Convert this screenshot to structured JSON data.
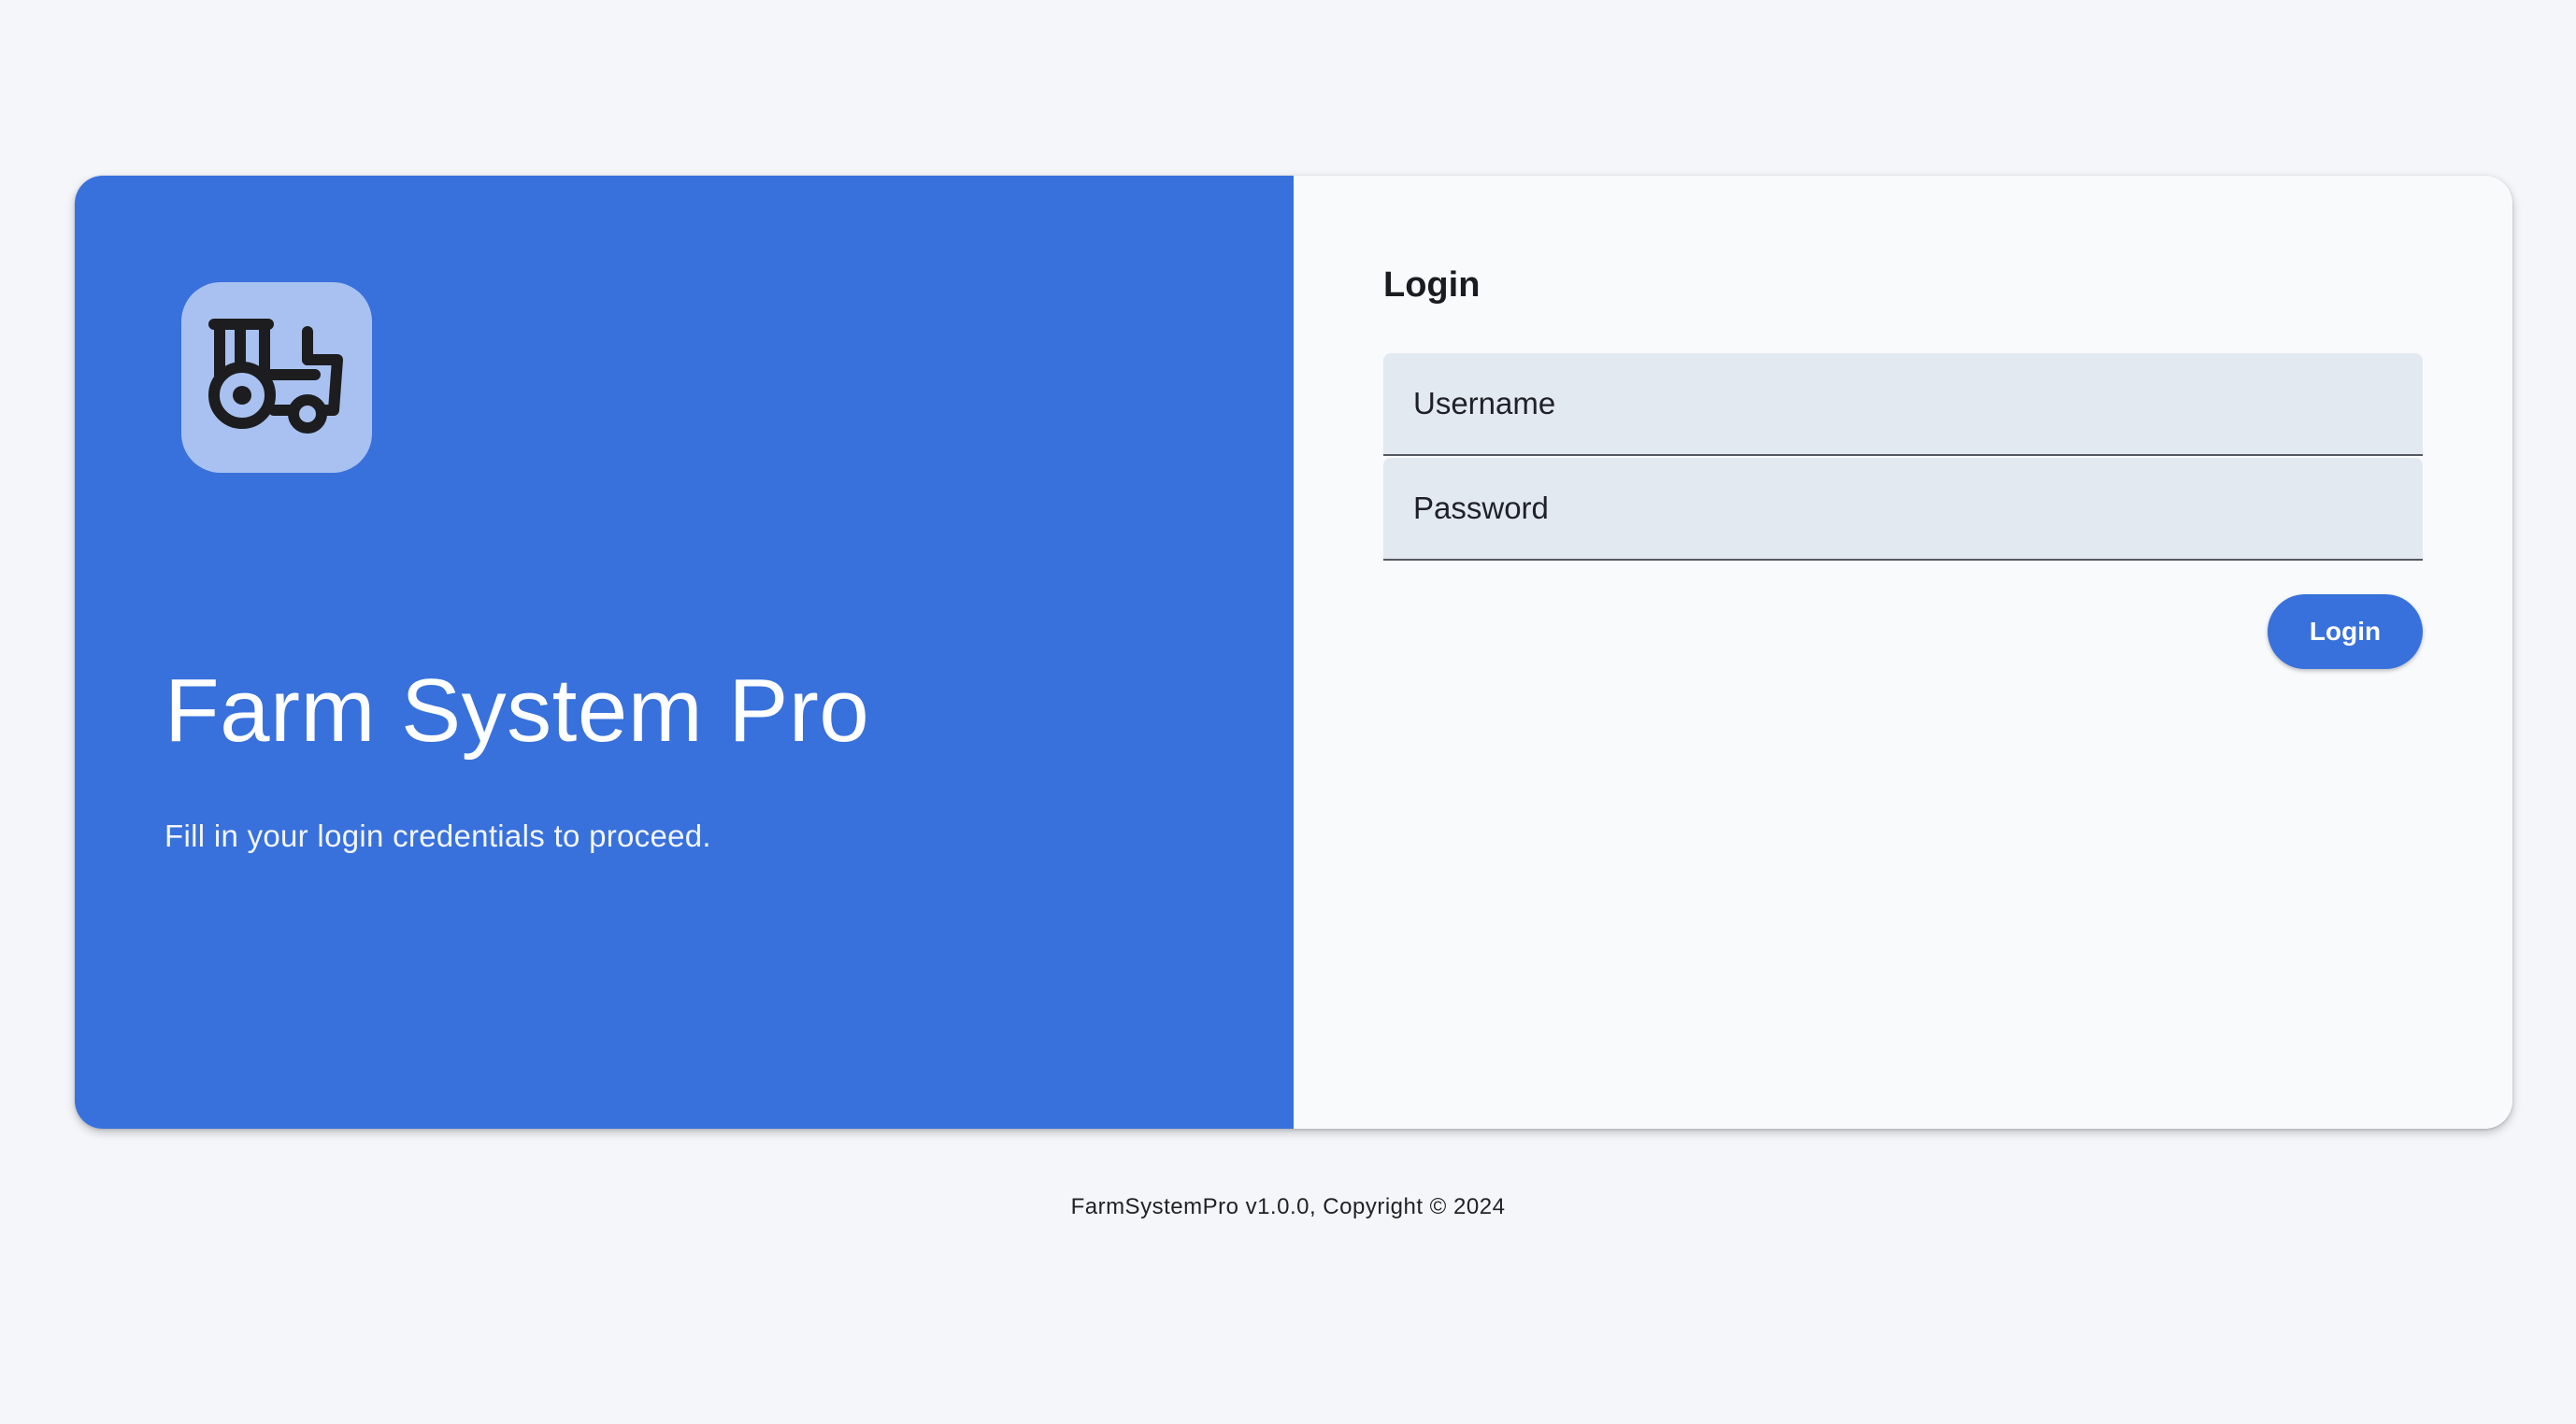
{
  "brand": {
    "logo_icon": "tractor-icon",
    "title": "Farm System Pro",
    "subtitle": "Fill in your login credentials to proceed."
  },
  "login": {
    "heading": "Login",
    "username_placeholder": "Username",
    "username_value": "",
    "password_placeholder": "Password",
    "password_value": "",
    "submit_label": "Login"
  },
  "footer": {
    "text": "FarmSystemPro v1.0.0, Copyright © 2024"
  },
  "colors": {
    "primary": "#3871dc",
    "logo_tile": "#a8c1f0",
    "page_background": "#f4f6fa",
    "input_background": "#e3e9f1"
  }
}
